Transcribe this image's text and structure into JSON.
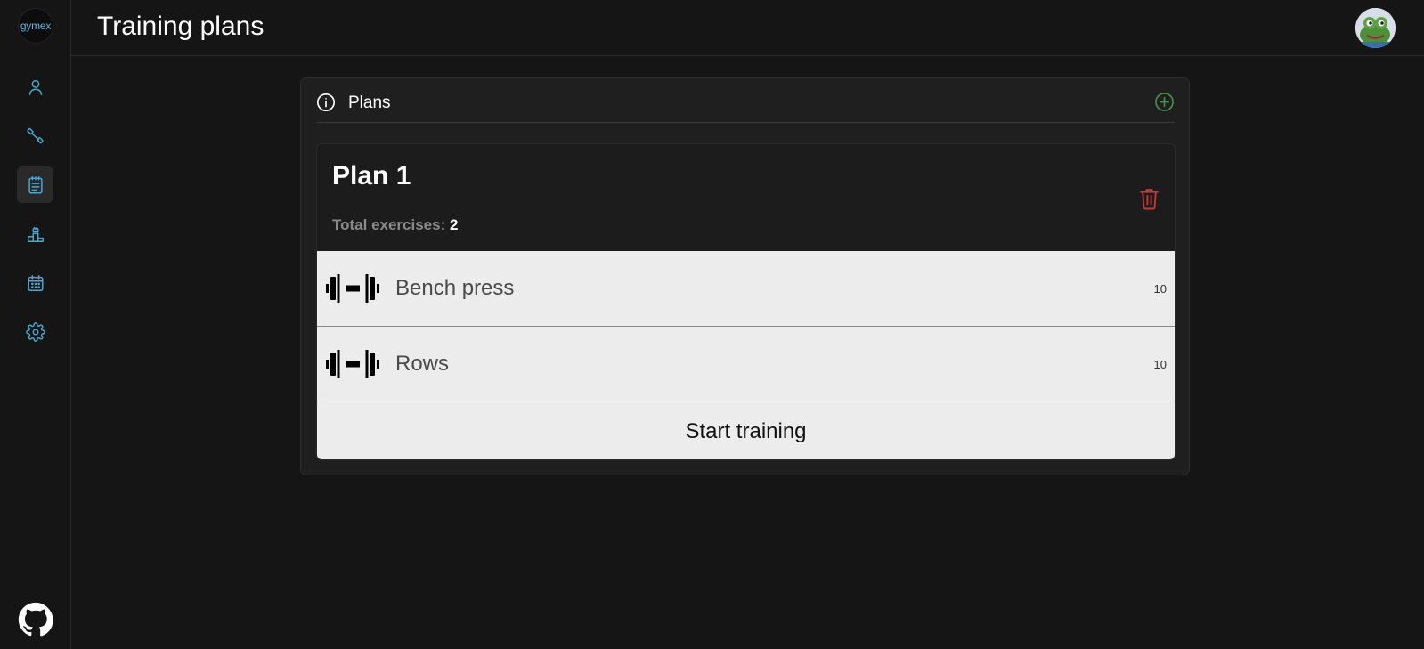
{
  "app": {
    "logo_text": "gymex"
  },
  "header": {
    "title": "Training plans"
  },
  "sidebar": {
    "items": [
      {
        "icon": "user-icon",
        "active": false
      },
      {
        "icon": "dumbbell-icon",
        "active": false
      },
      {
        "icon": "notepad-icon",
        "active": true
      },
      {
        "icon": "podium-icon",
        "active": false
      },
      {
        "icon": "calendar-icon",
        "active": false
      },
      {
        "icon": "gear-icon",
        "active": false
      }
    ],
    "footer_icon": "github-icon"
  },
  "panel": {
    "title": "Plans"
  },
  "plan": {
    "name": "Plan 1",
    "total_label": "Total exercises:",
    "total_value": "2",
    "exercises": [
      {
        "name": "Bench press",
        "count": "10"
      },
      {
        "name": "Rows",
        "count": "10"
      }
    ],
    "start_label": "Start training"
  },
  "colors": {
    "background": "#151515",
    "accent": "#4aa8cf",
    "add": "#4c8f4c",
    "delete": "#c0393b",
    "row_bg": "#ececec"
  }
}
